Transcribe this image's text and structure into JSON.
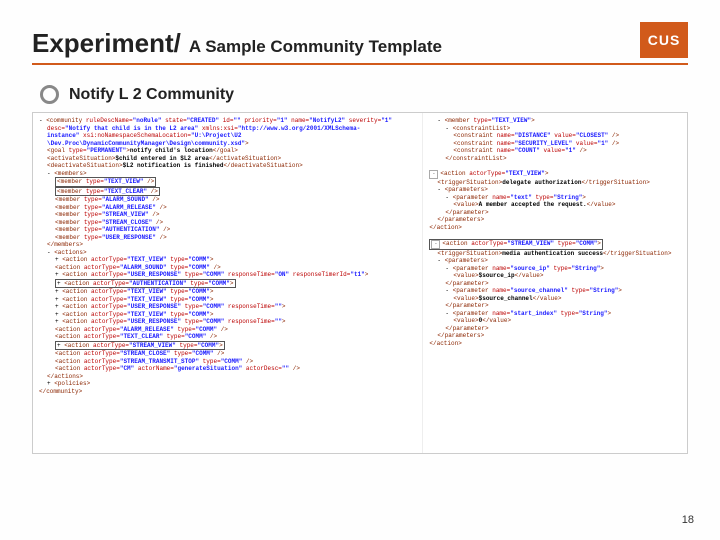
{
  "header": {
    "title_main": "Experiment/",
    "title_sub": "A Sample Community Template",
    "logo_text": "CUS"
  },
  "bullet": {
    "text": "Notify L 2 Community"
  },
  "left_col": [
    {
      "cls": "",
      "html": "- <span class='tag'>&lt;community</span> <span class='attr'>ruleDescName=</span><span class='val'>\"noRule\"</span> <span class='attr'>state=</span><span class='val'>\"CREATED\"</span> <span class='attr'>id=</span><span class='val'>\"\"</span> <span class='attr'>priority=</span><span class='val'>\"1\"</span> <span class='attr'>name=</span><span class='val'>\"NotifyL2\"</span> <span class='attr'>severity=</span><span class='val'>\"1\"</span>"
    },
    {
      "cls": "i1",
      "html": "<span class='attr'>desc=</span><span class='val'>\"Notify that child is in the L2 area\"</span> <span class='attr'>xmlns:xsi=</span><span class='val'>\"http://www.w3.org/2001/XMLSchema-</span>"
    },
    {
      "cls": "i1",
      "html": "<span class='val'>instance\"</span> <span class='attr'>xsi:noNamespaceSchemaLocation=</span><span class='val'>\"U:\\Project\\U2</span>"
    },
    {
      "cls": "i1",
      "html": "<span class='val'>\\Dev.Proc\\DynamicCommunityManager\\Design\\community.xsd\"</span><span class='tag'>&gt;</span>"
    },
    {
      "cls": "i1",
      "html": "<span class='tag'>&lt;goal</span> <span class='attr'>type=</span><span class='val'>\"PERMANENT\"</span><span class='tag'>&gt;</span><span class='txt'>notify child's location</span><span class='tag'>&lt;/goal&gt;</span>"
    },
    {
      "cls": "i1",
      "html": "<span class='tag'>&lt;activateSituation&gt;</span><span class='txt'>$child entered in $L2 area</span><span class='tag'>&lt;/activateSituation&gt;</span>"
    },
    {
      "cls": "i1",
      "html": "<span class='tag'>&lt;deactivateSituation&gt;</span><span class='txt'>$L2 notification is finished</span><span class='tag'>&lt;/deactivateSituation&gt;</span>"
    },
    {
      "cls": "i1",
      "html": "- <span class='tag'>&lt;members&gt;</span>"
    },
    {
      "cls": "i2",
      "html": "<span class='boxed'><span class='tag'>&lt;member</span> <span class='attr'>type=</span><span class='val'>\"TEXT_VIEW\"</span> <span class='tag'>/&gt;</span></span>"
    },
    {
      "cls": "i2",
      "html": "<span class='boxed'><span class='tag'>&lt;member</span> <span class='attr'>type=</span><span class='val'>\"TEXT_CLEAR\"</span> <span class='tag'>/&gt;</span></span>"
    },
    {
      "cls": "i2",
      "html": "<span class='tag'>&lt;member</span> <span class='attr'>type=</span><span class='val'>\"ALARM_SOUND\"</span> <span class='tag'>/&gt;</span>"
    },
    {
      "cls": "i2",
      "html": "<span class='tag'>&lt;member</span> <span class='attr'>type=</span><span class='val'>\"ALARM_RELEASE\"</span> <span class='tag'>/&gt;</span>"
    },
    {
      "cls": "i2",
      "html": "<span class='tag'>&lt;member</span> <span class='attr'>type=</span><span class='val'>\"STREAM_VIEW\"</span> <span class='tag'>/&gt;</span>"
    },
    {
      "cls": "i2",
      "html": "<span class='tag'>&lt;member</span> <span class='attr'>type=</span><span class='val'>\"STREAM_CLOSE\"</span> <span class='tag'>/&gt;</span>"
    },
    {
      "cls": "i2",
      "html": "<span class='tag'>&lt;member</span> <span class='attr'>type=</span><span class='val'>\"AUTHENTICATION\"</span> <span class='tag'>/&gt;</span>"
    },
    {
      "cls": "i2",
      "html": "<span class='tag'>&lt;member</span> <span class='attr'>type=</span><span class='val'>\"USER_RESPONSE\"</span> <span class='tag'>/&gt;</span>"
    },
    {
      "cls": "i1",
      "html": "<span class='tag'>&lt;/members&gt;</span>"
    },
    {
      "cls": "i1",
      "html": "- <span class='tag'>&lt;actions&gt;</span>"
    },
    {
      "cls": "i2",
      "html": "+ <span class='tag'>&lt;action</span> <span class='attr'>actorType=</span><span class='val'>\"TEXT_VIEW\"</span> <span class='attr'>type=</span><span class='val'>\"COMM\"</span><span class='tag'>&gt;</span>"
    },
    {
      "cls": "i2",
      "html": "<span class='tag'>&lt;action</span> <span class='attr'>actorType=</span><span class='val'>\"ALARM_SOUND\"</span> <span class='attr'>type=</span><span class='val'>\"COMM\"</span> <span class='tag'>/&gt;</span>"
    },
    {
      "cls": "i2",
      "html": "+ <span class='tag'>&lt;action</span> <span class='attr'>actorType=</span><span class='val'>\"USER_RESPONSE\"</span> <span class='attr'>type=</span><span class='val'>\"COMM\"</span> <span class='attr'>responseTime=</span><span class='val'>\"ON\"</span> <span class='attr'>responseTimerId=</span><span class='val'>\"t1\"</span><span class='tag'>&gt;</span>"
    },
    {
      "cls": "i2",
      "html": "<span class='boxed'>+ <span class='tag'>&lt;action</span> <span class='attr'>actorType=</span><span class='val'>\"AUTHENTICATION\"</span> <span class='attr'>type=</span><span class='val'>\"COMM\"</span><span class='tag'>&gt;</span></span>"
    },
    {
      "cls": "i2",
      "html": "+ <span class='tag'>&lt;action</span> <span class='attr'>actorType=</span><span class='val'>\"TEXT_VIEW\"</span> <span class='attr'>type=</span><span class='val'>\"COMM\"</span><span class='tag'>&gt;</span>"
    },
    {
      "cls": "i2",
      "html": "+ <span class='tag'>&lt;action</span> <span class='attr'>actorType=</span><span class='val'>\"TEXT_VIEW\"</span> <span class='attr'>type=</span><span class='val'>\"COMM\"</span><span class='tag'>&gt;</span>"
    },
    {
      "cls": "i2",
      "html": "+ <span class='tag'>&lt;action</span> <span class='attr'>actorType=</span><span class='val'>\"USER_RESPONSE\"</span> <span class='attr'>type=</span><span class='val'>\"COMM\"</span> <span class='attr'>responseTime=</span><span class='val'>\"\"</span><span class='tag'>&gt;</span>"
    },
    {
      "cls": "i2",
      "html": "+ <span class='tag'>&lt;action</span> <span class='attr'>actorType=</span><span class='val'>\"TEXT_VIEW\"</span> <span class='attr'>type=</span><span class='val'>\"COMM\"</span><span class='tag'>&gt;</span>"
    },
    {
      "cls": "i2",
      "html": "+ <span class='tag'>&lt;action</span> <span class='attr'>actorType=</span><span class='val'>\"USER_RESPONSE\"</span> <span class='attr'>type=</span><span class='val'>\"COMM\"</span> <span class='attr'>responseTime=</span><span class='val'>\"\"</span><span class='tag'>&gt;</span>"
    },
    {
      "cls": "i2",
      "html": "<span class='tag'>&lt;action</span> <span class='attr'>actorType=</span><span class='val'>\"ALARM_RELEASE\"</span> <span class='attr'>type=</span><span class='val'>\"COMM\"</span> <span class='tag'>/&gt;</span>"
    },
    {
      "cls": "i2",
      "html": "<span class='tag'>&lt;action</span> <span class='attr'>actorType=</span><span class='val'>\"TEXT_CLEAR\"</span> <span class='attr'>type=</span><span class='val'>\"COMM\"</span> <span class='tag'>/&gt;</span>"
    },
    {
      "cls": "i2",
      "html": "<span class='boxed'>+ <span class='tag'>&lt;action</span> <span class='attr'>actorType=</span><span class='val'>\"STREAM_VIEW\"</span> <span class='attr'>type=</span><span class='val'>\"COMM\"</span><span class='tag'>&gt;</span></span>"
    },
    {
      "cls": "i2",
      "html": "<span class='tag'>&lt;action</span> <span class='attr'>actorType=</span><span class='val'>\"STREAM_CLOSE\"</span> <span class='attr'>type=</span><span class='val'>\"COMM\"</span> <span class='tag'>/&gt;</span>"
    },
    {
      "cls": "i2",
      "html": "<span class='tag'>&lt;action</span> <span class='attr'>actorType=</span><span class='val'>\"STREAM_TRANSMIT_STOP\"</span> <span class='attr'>type=</span><span class='val'>\"COMM\"</span> <span class='tag'>/&gt;</span>"
    },
    {
      "cls": "i2",
      "html": "<span class='tag'>&lt;action</span> <span class='attr'>actorType=</span><span class='val'>\"CM\"</span> <span class='attr'>actorName=</span><span class='val'>\"generateSituation\"</span> <span class='attr'>actorDesc=</span><span class='val'>\"\"</span> <span class='tag'>/&gt;</span>"
    },
    {
      "cls": "i1",
      "html": "<span class='tag'>&lt;/actions&gt;</span>"
    },
    {
      "cls": "i1",
      "html": "+ <span class='tag'>&lt;policies&gt;</span>"
    },
    {
      "cls": "",
      "html": "<span class='tag'>&lt;/community&gt;</span>"
    }
  ],
  "right_col": [
    {
      "cls": "i1",
      "html": "- <span class='tag'>&lt;member</span> <span class='attr'>type=</span><span class='val'>\"TEXT_VIEW\"</span><span class='tag'>&gt;</span>"
    },
    {
      "cls": "i2",
      "html": "- <span class='tag'>&lt;constraintList&gt;</span>"
    },
    {
      "cls": "i3",
      "html": "<span class='tag'>&lt;constraint</span> <span class='attr'>name=</span><span class='val'>\"DISTANCE\"</span> <span class='attr'>value=</span><span class='val'>\"CLOSEST\"</span> <span class='tag'>/&gt;</span>"
    },
    {
      "cls": "i3",
      "html": "<span class='tag'>&lt;constraint</span> <span class='attr'>name=</span><span class='val'>\"SECURITY_LEVEL\"</span> <span class='attr'>value=</span><span class='val'>\"1\"</span> <span class='tag'>/&gt;</span>"
    },
    {
      "cls": "i3",
      "html": "<span class='tag'>&lt;constraint</span> <span class='attr'>name=</span><span class='val'>\"COUNT\"</span> <span class='attr'>value=</span><span class='val'>\"1\"</span> <span class='tag'>/&gt;</span>"
    },
    {
      "cls": "i2",
      "html": "<span class='tag'>&lt;/constraintList&gt;</span>"
    },
    {
      "cls": "",
      "html": "&nbsp;"
    },
    {
      "cls": "",
      "html": "<span class='toggle'>-</span><span class='tag'>&lt;action</span> <span class='attr'>actorType=</span><span class='val'>\"TEXT_VIEW\"</span><span class='tag'>&gt;</span>"
    },
    {
      "cls": "i1",
      "html": "<span class='tag'>&lt;triggerSituation&gt;</span><span class='txt'>delegate authorization</span><span class='tag'>&lt;/triggerSituation&gt;</span>"
    },
    {
      "cls": "i1",
      "html": "- <span class='tag'>&lt;parameters&gt;</span>"
    },
    {
      "cls": "i2",
      "html": "- <span class='tag'>&lt;parameter</span> <span class='attr'>name=</span><span class='val'>\"text\"</span> <span class='attr'>type=</span><span class='val'>\"String\"</span><span class='tag'>&gt;</span>"
    },
    {
      "cls": "i3",
      "html": "<span class='tag'>&lt;value&gt;</span><span class='txt'>A member accepted the request.</span><span class='tag'>&lt;/value&gt;</span>"
    },
    {
      "cls": "i2",
      "html": "<span class='tag'>&lt;/parameter&gt;</span>"
    },
    {
      "cls": "i1",
      "html": "<span class='tag'>&lt;/parameters&gt;</span>"
    },
    {
      "cls": "",
      "html": "<span class='tag'>&lt;/action&gt;</span>"
    },
    {
      "cls": "",
      "html": "&nbsp;"
    },
    {
      "cls": "",
      "html": "<span class='boxed'><span class='toggle'>-</span><span class='tag'>&lt;action</span> <span class='attr'>actorType=</span><span class='val'>\"STREAM_VIEW\"</span> <span class='attr'>type=</span><span class='val'>\"COMM\"</span><span class='tag'>&gt;</span></span>"
    },
    {
      "cls": "i1",
      "html": "<span class='tag'>&lt;triggerSituation&gt;</span><span class='txt'>media authentication success</span><span class='tag'>&lt;/triggerSituation&gt;</span>"
    },
    {
      "cls": "i1",
      "html": "- <span class='tag'>&lt;parameters&gt;</span>"
    },
    {
      "cls": "i2",
      "html": "- <span class='tag'>&lt;parameter</span> <span class='attr'>name=</span><span class='val'>\"source_ip\"</span> <span class='attr'>type=</span><span class='val'>\"String\"</span><span class='tag'>&gt;</span>"
    },
    {
      "cls": "i3",
      "html": "<span class='tag'>&lt;value&gt;</span><span class='txt'>$source_ip</span><span class='tag'>&lt;/value&gt;</span>"
    },
    {
      "cls": "i2",
      "html": "<span class='tag'>&lt;/parameter&gt;</span>"
    },
    {
      "cls": "i2",
      "html": "- <span class='tag'>&lt;parameter</span> <span class='attr'>name=</span><span class='val'>\"source_channel\"</span> <span class='attr'>type=</span><span class='val'>\"String\"</span><span class='tag'>&gt;</span>"
    },
    {
      "cls": "i3",
      "html": "<span class='tag'>&lt;value&gt;</span><span class='txt'>$source_channel</span><span class='tag'>&lt;/value&gt;</span>"
    },
    {
      "cls": "i2",
      "html": "<span class='tag'>&lt;/parameter&gt;</span>"
    },
    {
      "cls": "i2",
      "html": "- <span class='tag'>&lt;parameter</span> <span class='attr'>name=</span><span class='val'>\"start_index\"</span> <span class='attr'>type=</span><span class='val'>\"String\"</span><span class='tag'>&gt;</span>"
    },
    {
      "cls": "i3",
      "html": "<span class='tag'>&lt;value&gt;</span><span class='txt'>0</span><span class='tag'>&lt;/value&gt;</span>"
    },
    {
      "cls": "i2",
      "html": "<span class='tag'>&lt;/parameter&gt;</span>"
    },
    {
      "cls": "i1",
      "html": "<span class='tag'>&lt;/parameters&gt;</span>"
    },
    {
      "cls": "",
      "html": "<span class='tag'>&lt;/action&gt;</span>"
    }
  ],
  "pagenum": "18"
}
